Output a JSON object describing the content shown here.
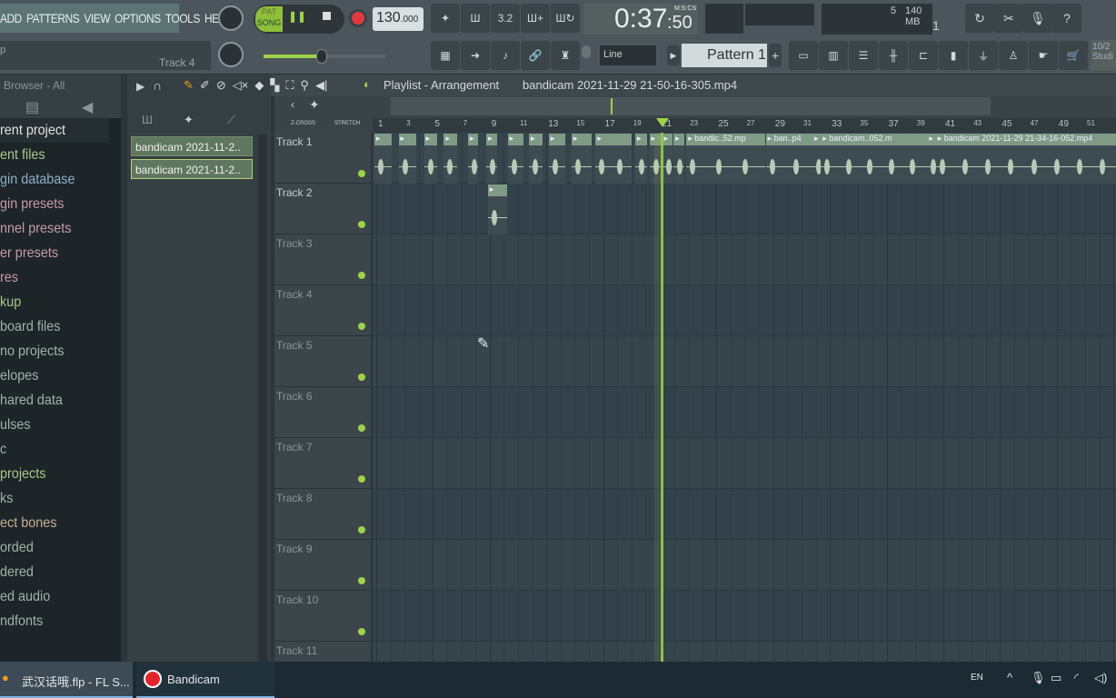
{
  "menu": [
    "ADD",
    "PATTERNS",
    "VIEW",
    "OPTIONS",
    "TOOLS",
    "HELP"
  ],
  "hint": {
    "left": "p",
    "right": "Track 4"
  },
  "transport": {
    "pat": "PAT",
    "song": "SONG",
    "tempo": "130",
    "tempo_dec": ".000"
  },
  "time": {
    "main": "0:37",
    "cs": ":50",
    "unit": "M:S:CS"
  },
  "cpu": {
    "voices": "5",
    "memory": "140 MB",
    "poly": "1"
  },
  "snap": "Line",
  "pattern": "Pattern 1",
  "news": {
    "line1": "10/2",
    "line2": "Studi"
  },
  "browser": {
    "title": "Browser - All",
    "items": [
      {
        "t": "rent project",
        "c": "#e6e1d8"
      },
      {
        "t": "ent files",
        "c": "#a7c78b"
      },
      {
        "t": "gin database",
        "c": "#8fb0c7"
      },
      {
        "t": "gin presets",
        "c": "#c79aa8"
      },
      {
        "t": "nnel presets",
        "c": "#c79aa8"
      },
      {
        "t": "er presets",
        "c": "#c79aa8"
      },
      {
        "t": "res",
        "c": "#c79aa8"
      },
      {
        "t": "kup",
        "c": "#a7c78b"
      },
      {
        "t": "board files",
        "c": "#9fb3a8"
      },
      {
        "t": "no projects",
        "c": "#9fb3a8"
      },
      {
        "t": "elopes",
        "c": "#9fb3a8"
      },
      {
        "t": "hared data",
        "c": "#9fb3a8"
      },
      {
        "t": "ulses",
        "c": "#9fb3a8"
      },
      {
        "t": "c",
        "c": "#9fb3a8"
      },
      {
        "t": "projects",
        "c": "#a7c78b"
      },
      {
        "t": "ks",
        "c": "#9fb3a8"
      },
      {
        "t": "ect bones",
        "c": "#c7b08f"
      },
      {
        "t": "orded",
        "c": "#9fb3a8"
      },
      {
        "t": "dered",
        "c": "#9fb3a8"
      },
      {
        "t": "ed audio",
        "c": "#9fb3a8"
      },
      {
        "t": "ndfonts",
        "c": "#9fb3a8"
      }
    ]
  },
  "picker": [
    "bandicam 2021-11-2..",
    "bandicam 2021-11-2.."
  ],
  "playlist": {
    "title": "Playlist - Arrangement",
    "crumb": "bandicam 2021-11-29 21-50-16-305.mp4",
    "zcross": "Z-CROSS",
    "stretch": "STRETCH"
  },
  "ruler": [
    1,
    3,
    5,
    7,
    9,
    11,
    13,
    15,
    17,
    19,
    21,
    23,
    25,
    27,
    29,
    31,
    33,
    35,
    37,
    39,
    41,
    43,
    45,
    47,
    49,
    51
  ],
  "playhead_bar": 21,
  "tracks": [
    "Track 1",
    "Track 2",
    "Track 3",
    "Track 4",
    "Track 5",
    "Track 6",
    "Track 7",
    "Track 8",
    "Track 9",
    "Track 10",
    "Track 11"
  ],
  "clips": [
    {
      "track": 0,
      "bar": 1,
      "len": 1.3,
      "label": ""
    },
    {
      "track": 0,
      "bar": 2.7,
      "len": 1.3,
      "label": ""
    },
    {
      "track": 0,
      "bar": 4.5,
      "len": 1,
      "label": ""
    },
    {
      "track": 0,
      "bar": 5.9,
      "len": 1,
      "label": ""
    },
    {
      "track": 0,
      "bar": 7.6,
      "len": 0.8,
      "label": ""
    },
    {
      "track": 0,
      "bar": 8.9,
      "len": 0.8,
      "label": ""
    },
    {
      "track": 0,
      "bar": 10.4,
      "len": 1.2,
      "label": ""
    },
    {
      "track": 0,
      "bar": 11.9,
      "len": 1,
      "label": ""
    },
    {
      "track": 0,
      "bar": 13.3,
      "len": 1.2,
      "label": ""
    },
    {
      "track": 0,
      "bar": 14.9,
      "len": 1.5,
      "label": ""
    },
    {
      "track": 0,
      "bar": 16.6,
      "len": 2.6,
      "label": ""
    },
    {
      "track": 0,
      "bar": 19.4,
      "len": 0.9,
      "label": ""
    },
    {
      "track": 0,
      "bar": 20.4,
      "len": 0.9,
      "label": ""
    },
    {
      "track": 0,
      "bar": 21.3,
      "len": 0.8,
      "label": ""
    },
    {
      "track": 0,
      "bar": 22.1,
      "len": 0.8,
      "label": ""
    },
    {
      "track": 0,
      "bar": 23,
      "len": 5.6,
      "label": "bandic..52.mp"
    },
    {
      "track": 0,
      "bar": 28.6,
      "len": 3.4,
      "label": "ban..p4"
    },
    {
      "track": 0,
      "bar": 31.9,
      "len": 0.8,
      "label": ""
    },
    {
      "track": 0,
      "bar": 32.5,
      "len": 7.6,
      "label": "bandicam..052.m"
    },
    {
      "track": 0,
      "bar": 40,
      "len": 0.7,
      "label": ""
    },
    {
      "track": 0,
      "bar": 40.6,
      "len": 13,
      "label": "bandicam 2021-11-29 21-34-16-052.mp4"
    },
    {
      "track": 1,
      "bar": 9,
      "len": 1.4,
      "label": ""
    }
  ],
  "taskbar": {
    "apps": [
      "武汉话哦.flp - FL S...",
      "Bandicam"
    ],
    "lang": "EN"
  },
  "colors": {
    "accent": "#9dd24a",
    "clip": "#7f9b86",
    "wave": "#b9cbb7"
  }
}
